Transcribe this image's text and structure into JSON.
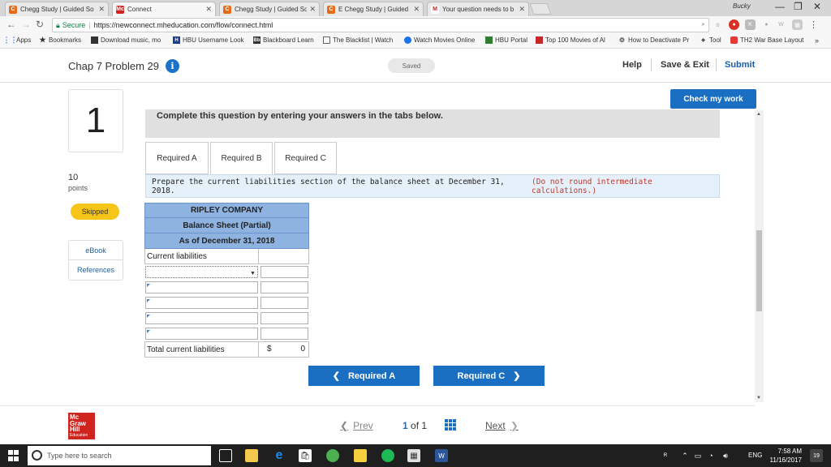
{
  "browser": {
    "tabs": [
      {
        "title": "Chegg Study | Guided So",
        "favicon": "C",
        "color": "#e66b17"
      },
      {
        "title": "Connect",
        "favicon": "Mc",
        "color": "#d0241f"
      },
      {
        "title": "Chegg Study | Guided So",
        "favicon": "C",
        "color": "#e66b17"
      },
      {
        "title": "E Chegg Study | Guided",
        "favicon": "C",
        "color": "#e66b17"
      },
      {
        "title": "Your question needs to b",
        "favicon": "M",
        "color": "#c5221f"
      }
    ],
    "secure_label": "Secure",
    "url": "https://newconnect.mheducation.com/flow/connect.html",
    "profile_name": "Bucky",
    "bookmarks": [
      {
        "label": "Apps"
      },
      {
        "label": "Bookmarks"
      },
      {
        "label": "Download music, mo"
      },
      {
        "label": "HBU Username Look"
      },
      {
        "label": "Blackboard Learn"
      },
      {
        "label": "The Blacklist | Watch"
      },
      {
        "label": "Watch Movies Online"
      },
      {
        "label": "HBU Portal"
      },
      {
        "label": "Top 100 Movies of Al"
      },
      {
        "label": "How to Deactivate Pr"
      },
      {
        "label": "Tool"
      },
      {
        "label": "TH2 War Base Layout"
      }
    ]
  },
  "header": {
    "problem_title": "Chap 7 Problem 29",
    "saved_label": "Saved",
    "help_label": "Help",
    "save_exit_label": "Save & Exit",
    "submit_label": "Submit"
  },
  "left_panel": {
    "question_number": "1",
    "points_value": "10",
    "points_label": "points",
    "status": "Skipped",
    "ebook_label": "eBook",
    "references_label": "References"
  },
  "question": {
    "check_label": "Check my work",
    "instruction": "Complete this question by entering your answers in the tabs below.",
    "tabs": [
      {
        "label": "Required A"
      },
      {
        "label": "Required B"
      },
      {
        "label": "Required C"
      }
    ],
    "prompt": "Prepare the current liabilities section of the balance sheet at December 31, 2018.",
    "prompt_note": "(Do not round intermediate calculations.)"
  },
  "balance_sheet": {
    "company": "RIPLEY COMPANY",
    "title": "Balance Sheet (Partial)",
    "date": "As of December 31, 2018",
    "section_label": "Current liabilities",
    "total_label": "Total current liabilities",
    "currency": "$",
    "total_value": "0"
  },
  "navigation": {
    "prev_required": "Required A",
    "next_required": "Required C",
    "prev_label": "Prev",
    "page_current": "1",
    "page_of": "of 1",
    "next_label": "Next"
  },
  "footer": {
    "logo_text": [
      "Mc",
      "Graw",
      "Hill"
    ],
    "logo_sub": "Education"
  },
  "taskbar": {
    "search_placeholder": "Type here to search",
    "lang": "ENG",
    "time": "7:58 AM",
    "date": "11/16/2017",
    "notifications": "19"
  }
}
